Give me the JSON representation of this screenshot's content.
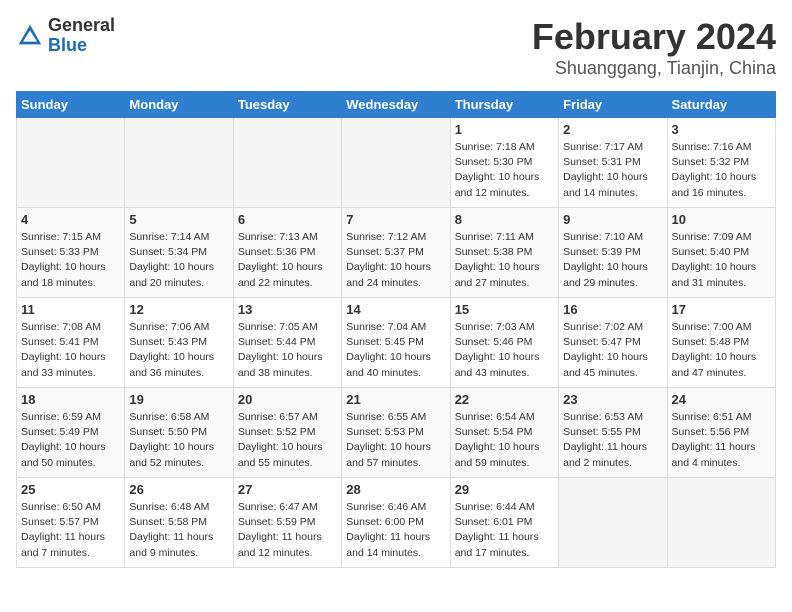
{
  "logo": {
    "general": "General",
    "blue": "Blue"
  },
  "title": {
    "month": "February 2024",
    "location": "Shuanggang, Tianjin, China"
  },
  "weekdays": [
    "Sunday",
    "Monday",
    "Tuesday",
    "Wednesday",
    "Thursday",
    "Friday",
    "Saturday"
  ],
  "weeks": [
    [
      {
        "day": "",
        "info": ""
      },
      {
        "day": "",
        "info": ""
      },
      {
        "day": "",
        "info": ""
      },
      {
        "day": "",
        "info": ""
      },
      {
        "day": "1",
        "info": "Sunrise: 7:18 AM\nSunset: 5:30 PM\nDaylight: 10 hours\nand 12 minutes."
      },
      {
        "day": "2",
        "info": "Sunrise: 7:17 AM\nSunset: 5:31 PM\nDaylight: 10 hours\nand 14 minutes."
      },
      {
        "day": "3",
        "info": "Sunrise: 7:16 AM\nSunset: 5:32 PM\nDaylight: 10 hours\nand 16 minutes."
      }
    ],
    [
      {
        "day": "4",
        "info": "Sunrise: 7:15 AM\nSunset: 5:33 PM\nDaylight: 10 hours\nand 18 minutes."
      },
      {
        "day": "5",
        "info": "Sunrise: 7:14 AM\nSunset: 5:34 PM\nDaylight: 10 hours\nand 20 minutes."
      },
      {
        "day": "6",
        "info": "Sunrise: 7:13 AM\nSunset: 5:36 PM\nDaylight: 10 hours\nand 22 minutes."
      },
      {
        "day": "7",
        "info": "Sunrise: 7:12 AM\nSunset: 5:37 PM\nDaylight: 10 hours\nand 24 minutes."
      },
      {
        "day": "8",
        "info": "Sunrise: 7:11 AM\nSunset: 5:38 PM\nDaylight: 10 hours\nand 27 minutes."
      },
      {
        "day": "9",
        "info": "Sunrise: 7:10 AM\nSunset: 5:39 PM\nDaylight: 10 hours\nand 29 minutes."
      },
      {
        "day": "10",
        "info": "Sunrise: 7:09 AM\nSunset: 5:40 PM\nDaylight: 10 hours\nand 31 minutes."
      }
    ],
    [
      {
        "day": "11",
        "info": "Sunrise: 7:08 AM\nSunset: 5:41 PM\nDaylight: 10 hours\nand 33 minutes."
      },
      {
        "day": "12",
        "info": "Sunrise: 7:06 AM\nSunset: 5:43 PM\nDaylight: 10 hours\nand 36 minutes."
      },
      {
        "day": "13",
        "info": "Sunrise: 7:05 AM\nSunset: 5:44 PM\nDaylight: 10 hours\nand 38 minutes."
      },
      {
        "day": "14",
        "info": "Sunrise: 7:04 AM\nSunset: 5:45 PM\nDaylight: 10 hours\nand 40 minutes."
      },
      {
        "day": "15",
        "info": "Sunrise: 7:03 AM\nSunset: 5:46 PM\nDaylight: 10 hours\nand 43 minutes."
      },
      {
        "day": "16",
        "info": "Sunrise: 7:02 AM\nSunset: 5:47 PM\nDaylight: 10 hours\nand 45 minutes."
      },
      {
        "day": "17",
        "info": "Sunrise: 7:00 AM\nSunset: 5:48 PM\nDaylight: 10 hours\nand 47 minutes."
      }
    ],
    [
      {
        "day": "18",
        "info": "Sunrise: 6:59 AM\nSunset: 5:49 PM\nDaylight: 10 hours\nand 50 minutes."
      },
      {
        "day": "19",
        "info": "Sunrise: 6:58 AM\nSunset: 5:50 PM\nDaylight: 10 hours\nand 52 minutes."
      },
      {
        "day": "20",
        "info": "Sunrise: 6:57 AM\nSunset: 5:52 PM\nDaylight: 10 hours\nand 55 minutes."
      },
      {
        "day": "21",
        "info": "Sunrise: 6:55 AM\nSunset: 5:53 PM\nDaylight: 10 hours\nand 57 minutes."
      },
      {
        "day": "22",
        "info": "Sunrise: 6:54 AM\nSunset: 5:54 PM\nDaylight: 10 hours\nand 59 minutes."
      },
      {
        "day": "23",
        "info": "Sunrise: 6:53 AM\nSunset: 5:55 PM\nDaylight: 11 hours\nand 2 minutes."
      },
      {
        "day": "24",
        "info": "Sunrise: 6:51 AM\nSunset: 5:56 PM\nDaylight: 11 hours\nand 4 minutes."
      }
    ],
    [
      {
        "day": "25",
        "info": "Sunrise: 6:50 AM\nSunset: 5:57 PM\nDaylight: 11 hours\nand 7 minutes."
      },
      {
        "day": "26",
        "info": "Sunrise: 6:48 AM\nSunset: 5:58 PM\nDaylight: 11 hours\nand 9 minutes."
      },
      {
        "day": "27",
        "info": "Sunrise: 6:47 AM\nSunset: 5:59 PM\nDaylight: 11 hours\nand 12 minutes."
      },
      {
        "day": "28",
        "info": "Sunrise: 6:46 AM\nSunset: 6:00 PM\nDaylight: 11 hours\nand 14 minutes."
      },
      {
        "day": "29",
        "info": "Sunrise: 6:44 AM\nSunset: 6:01 PM\nDaylight: 11 hours\nand 17 minutes."
      },
      {
        "day": "",
        "info": ""
      },
      {
        "day": "",
        "info": ""
      }
    ]
  ]
}
